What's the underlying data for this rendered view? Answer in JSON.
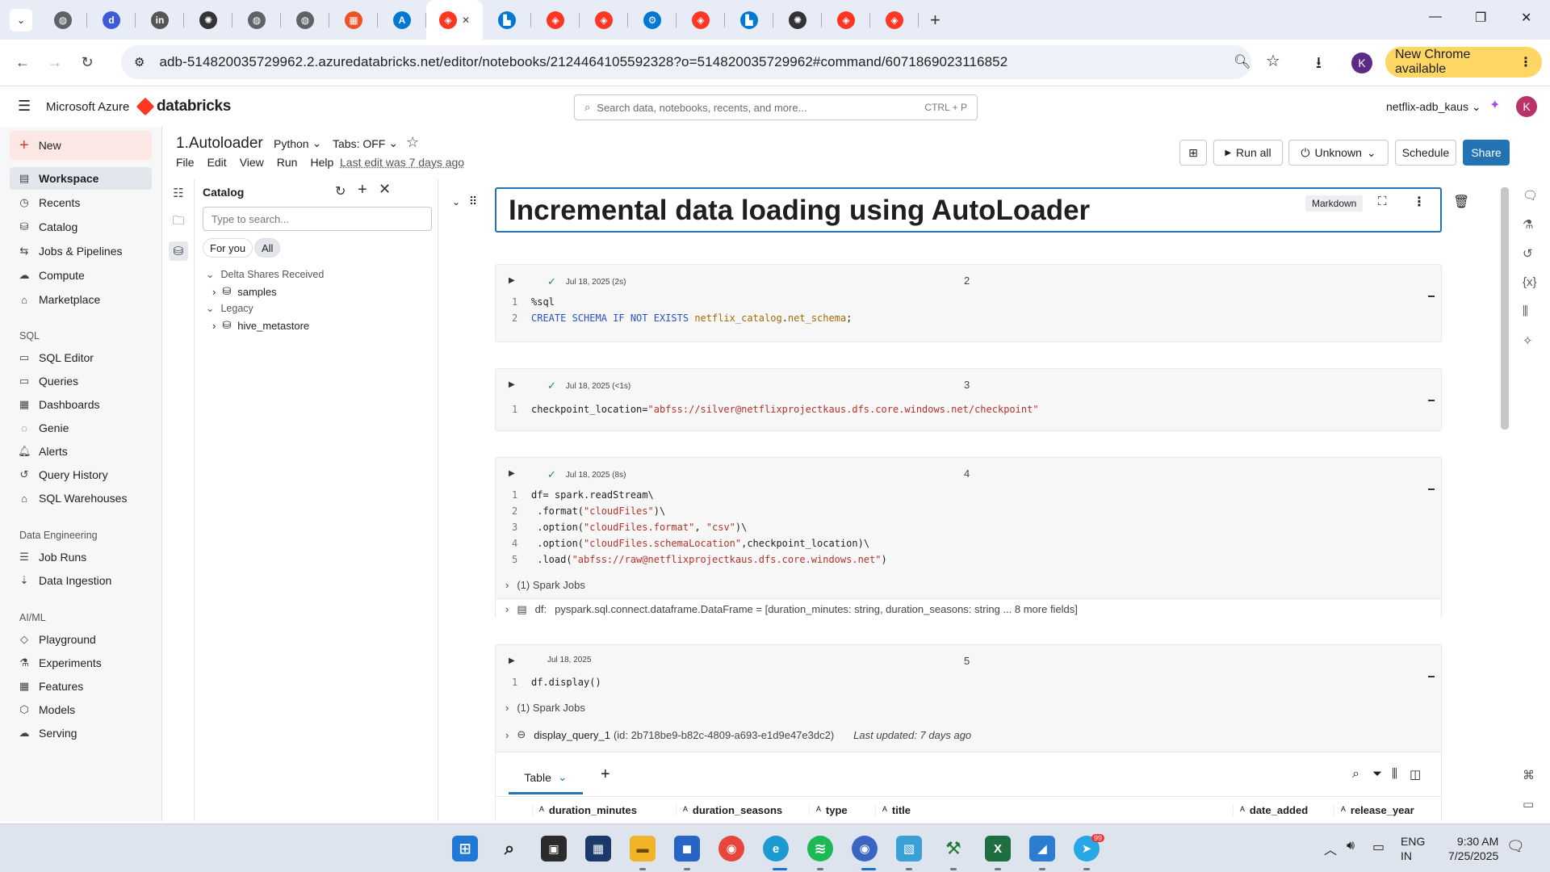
{
  "browser": {
    "address": "adb-514820035729962.2.azuredatabricks.net/editor/notebooks/2124464105592328?o=514820035729962#command/6071869023116852",
    "update_chip": "New Chrome available",
    "profile_initial": "K",
    "tabs": [
      {
        "icon": "globe-icon",
        "color": "#5f6368"
      },
      {
        "icon": "d-icon",
        "color": "#3b5bdb"
      },
      {
        "icon": "linkedin-icon",
        "color": "#555555"
      },
      {
        "icon": "openai-icon",
        "color": "#333333"
      },
      {
        "icon": "globe-icon",
        "color": "#5f6368"
      },
      {
        "icon": "globe-icon",
        "color": "#5f6368"
      },
      {
        "icon": "microsoft-icon",
        "color": "#f25022"
      },
      {
        "icon": "azure-icon",
        "color": "#0078d4"
      },
      {
        "icon": "databricks-icon",
        "color": "#ff3621"
      },
      {
        "icon": "azure-storage-icon",
        "color": "#0078d4"
      },
      {
        "icon": "databricks-icon",
        "color": "#ff3621"
      },
      {
        "icon": "databricks-icon",
        "color": "#ff3621"
      },
      {
        "icon": "gear-icon",
        "color": "#0078d4"
      },
      {
        "icon": "databricks-icon",
        "color": "#ff3621"
      },
      {
        "icon": "azure-storage-icon",
        "color": "#0078d4"
      },
      {
        "icon": "openai-icon",
        "color": "#333333"
      },
      {
        "icon": "databricks-icon",
        "color": "#ff3621"
      },
      {
        "icon": "databricks-icon",
        "color": "#ff3621"
      }
    ]
  },
  "header": {
    "azure": "Microsoft Azure",
    "brand": "databricks",
    "search_placeholder": "Search data, notebooks, recents, and more...",
    "search_shortcut": "CTRL + P",
    "workspace": "netflix-adb_kaus",
    "avatar": "K"
  },
  "nav": {
    "new": "New",
    "items": [
      "Workspace",
      "Recents",
      "Catalog",
      "Jobs & Pipelines",
      "Compute",
      "Marketplace"
    ],
    "sql_title": "SQL",
    "sql_items": [
      "SQL Editor",
      "Queries",
      "Dashboards",
      "Genie",
      "Alerts",
      "Query History",
      "SQL Warehouses"
    ],
    "de_title": "Data Engineering",
    "de_items": [
      "Job Runs",
      "Data Ingestion"
    ],
    "ml_title": "AI/ML",
    "ml_items": [
      "Playground",
      "Experiments",
      "Features",
      "Models",
      "Serving"
    ]
  },
  "notebook": {
    "title": "1.Autoloader",
    "language": "Python",
    "tabs": "Tabs: OFF",
    "menus": [
      "File",
      "Edit",
      "View",
      "Run",
      "Help"
    ],
    "last_edit": "Last edit was 7 days ago",
    "run_all": "Run all",
    "compute": "Unknown",
    "schedule": "Schedule",
    "share": "Share"
  },
  "catalog": {
    "title": "Catalog",
    "search_placeholder": "Type to search...",
    "tab_foryou": "For you",
    "tab_all": "All",
    "group1": "Delta Shares Received",
    "item1": "samples",
    "group2": "Legacy",
    "item2": "hive_metastore"
  },
  "cells": {
    "md_title": "Incremental data loading using AutoLoader",
    "md_badge": "Markdown",
    "c2": {
      "status": "Jul 18, 2025 (2s)",
      "num": "2"
    },
    "c3": {
      "status": "Jul 18, 2025 (<1s)",
      "num": "3"
    },
    "c4": {
      "status": "Jul 18, 2025 (8s)",
      "num": "4"
    },
    "c5": {
      "status": "Jul 18, 2025",
      "num": "5"
    },
    "spark_jobs": "(1) Spark Jobs",
    "df_label": "df:",
    "df_type": "pyspark.sql.connect.dataframe.DataFrame = [duration_minutes: string, duration_seasons: string ... 8 more fields]",
    "display_query": "display_query_1",
    "display_id": "(id: 2b718be9-b82c-4809-a693-e1d9e47e3dc2)",
    "last_updated": "Last updated: 7 days ago",
    "table_tab": "Table",
    "columns": [
      "duration_minutes",
      "duration_seasons",
      "type",
      "title",
      "date_added",
      "release_year"
    ]
  },
  "taskbar": {
    "lang1": "ENG",
    "lang2": "IN",
    "time": "9:30 AM",
    "date": "7/25/2025",
    "badge": "99"
  }
}
